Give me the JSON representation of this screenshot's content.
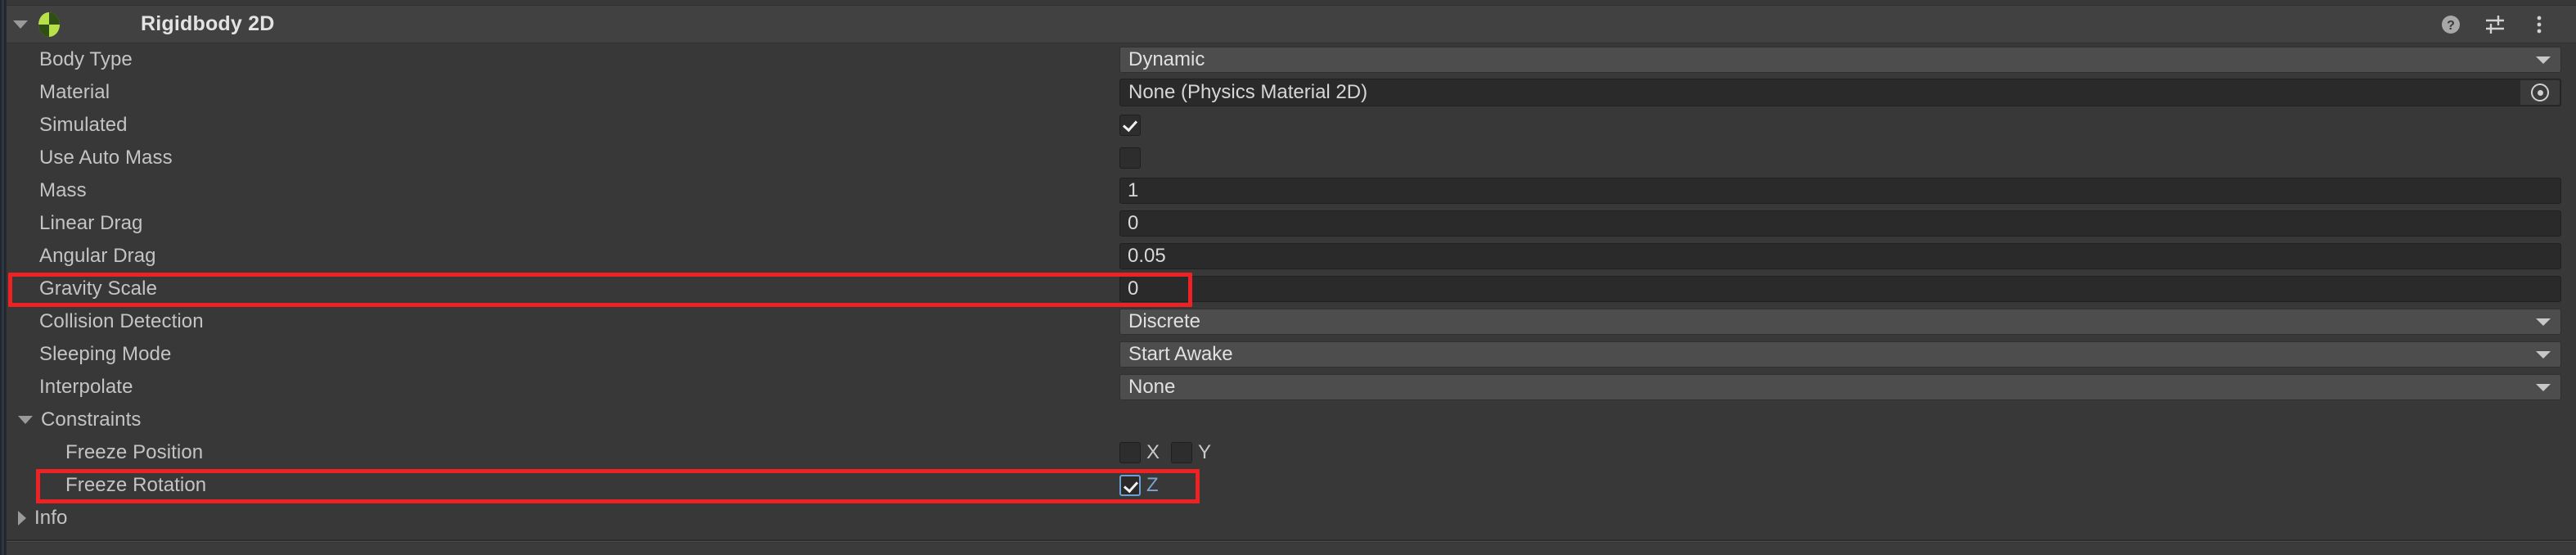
{
  "component": {
    "title": "Rigidbody 2D",
    "icon": "rigidbody2d-icon",
    "expanded": true,
    "foldout_icon": "triangle-down-icon",
    "header_buttons": [
      {
        "name": "help-icon",
        "glyph": "?"
      },
      {
        "name": "preset-settings-icon",
        "glyph": "sliders"
      },
      {
        "name": "more-options-icon",
        "glyph": "kebab"
      }
    ]
  },
  "properties": {
    "body_type": {
      "label": "Body Type",
      "value": "Dynamic"
    },
    "material": {
      "label": "Material",
      "value": "None (Physics Material 2D)"
    },
    "simulated": {
      "label": "Simulated",
      "checked": true
    },
    "use_auto_mass": {
      "label": "Use Auto Mass",
      "checked": false
    },
    "mass": {
      "label": "Mass",
      "value": "1"
    },
    "linear_drag": {
      "label": "Linear Drag",
      "value": "0"
    },
    "angular_drag": {
      "label": "Angular Drag",
      "value": "0.05"
    },
    "gravity_scale": {
      "label": "Gravity Scale",
      "value": "0"
    },
    "collision_detection": {
      "label": "Collision Detection",
      "value": "Discrete"
    },
    "sleeping_mode": {
      "label": "Sleeping Mode",
      "value": "Start Awake"
    },
    "interpolate": {
      "label": "Interpolate",
      "value": "None"
    }
  },
  "constraints": {
    "label": "Constraints",
    "expanded": true,
    "freeze_position": {
      "label": "Freeze Position",
      "axes": [
        {
          "axis": "X",
          "checked": false
        },
        {
          "axis": "Y",
          "checked": false
        }
      ]
    },
    "freeze_rotation": {
      "label": "Freeze Rotation",
      "axes": [
        {
          "axis": "Z",
          "checked": true
        }
      ]
    }
  },
  "info": {
    "label": "Info",
    "expanded": false
  },
  "annotations": {
    "highlight_color": "#ee2222",
    "boxes": [
      {
        "name": "gravity-scale-highlight",
        "target": "Gravity Scale"
      },
      {
        "name": "freeze-rotation-highlight",
        "target": "Freeze Rotation"
      }
    ]
  },
  "colors": {
    "panel_bg": "#383838",
    "header_bg": "#414141",
    "field_bg": "#2a2a2a",
    "dropdown_bg": "#4d4d4d",
    "text": "#c4c4c4",
    "accent_blue": "#7ea3cf",
    "icon_green": "#b7e04a"
  }
}
